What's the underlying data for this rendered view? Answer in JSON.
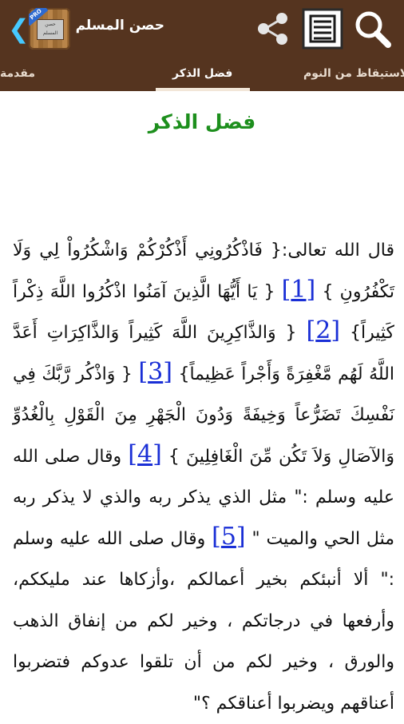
{
  "appbar": {
    "title": "حصن المسلم",
    "icon_name": "hisn-almuslim-book-icon",
    "icon_label": "حصن المسلم",
    "pro_badge": "PRO",
    "back_icon": "chevron-left-icon",
    "share_icon": "share-icon",
    "list_icon": "list-icon",
    "search_icon": "search-icon"
  },
  "tabs": [
    {
      "label": "الاستيقاظ من النوم"
    },
    {
      "label": "فضل الذكر"
    },
    {
      "label": "مقدمة"
    }
  ],
  "content": {
    "title": "فضل الذكر",
    "p1_a": "قال الله تعالى:{ فَاذْكُرُونِي أَذْكُرْكُمْ وَاشْكُرُواْ لِي وَلَا تَكْفُرُونِ }",
    "ref1": "[1]",
    "p1_b": "{ يَا أَيُّهَا الَّذِينَ آمَنُوا اذْكُرُوا اللَّهَ ذِكْراً كَثِيراً}",
    "ref2": "[2]",
    "p1_c": "{ وَالذَّاكِرِينَ اللَّهَ كَثِيراً وَالذَّاكِرَاتِ أَعَدَّ اللَّهُ لَهُم مَّغْفِرَةً وَأَجْراً عَظِيماً}",
    "ref3": "[3]",
    "p1_d": "{ وَاذْكُر رَّبَّكَ فِي نَفْسِكَ تَضَرُّعاً وَخِيفَةً وَدُونَ الْجَهْرِ مِنَ الْقَوْلِ بِالْغُدُوِّ وَالآصَالِ وَلاَ تَكُن مِّنَ الْغَافِلِينَ }",
    "ref4": "[4]",
    "p2_a": "وقال صلى الله عليه وسلم :\" مثل الذي يذكر ربه والذي لا يذكر ربه مثل الحي والميت \"",
    "ref5": "[5]",
    "p2_b": "وقال صلى الله عليه وسلم :\" ألا أنبئكم بخير أعمالكم ،وأزكاها عند مليككم، وأرفعها في درجاتكم ، وخير لكم من إنفاق الذهب والورق ، وخير لكم من أن تلقوا عدوكم فتضربوا أعناقهم ويضربوا أعناقكم ؟\""
  },
  "colors": {
    "appbar": "#55341f",
    "title_green": "#1d8f1d",
    "link_blue": "#1a2fd6",
    "back_arrow": "#46c9ff"
  }
}
